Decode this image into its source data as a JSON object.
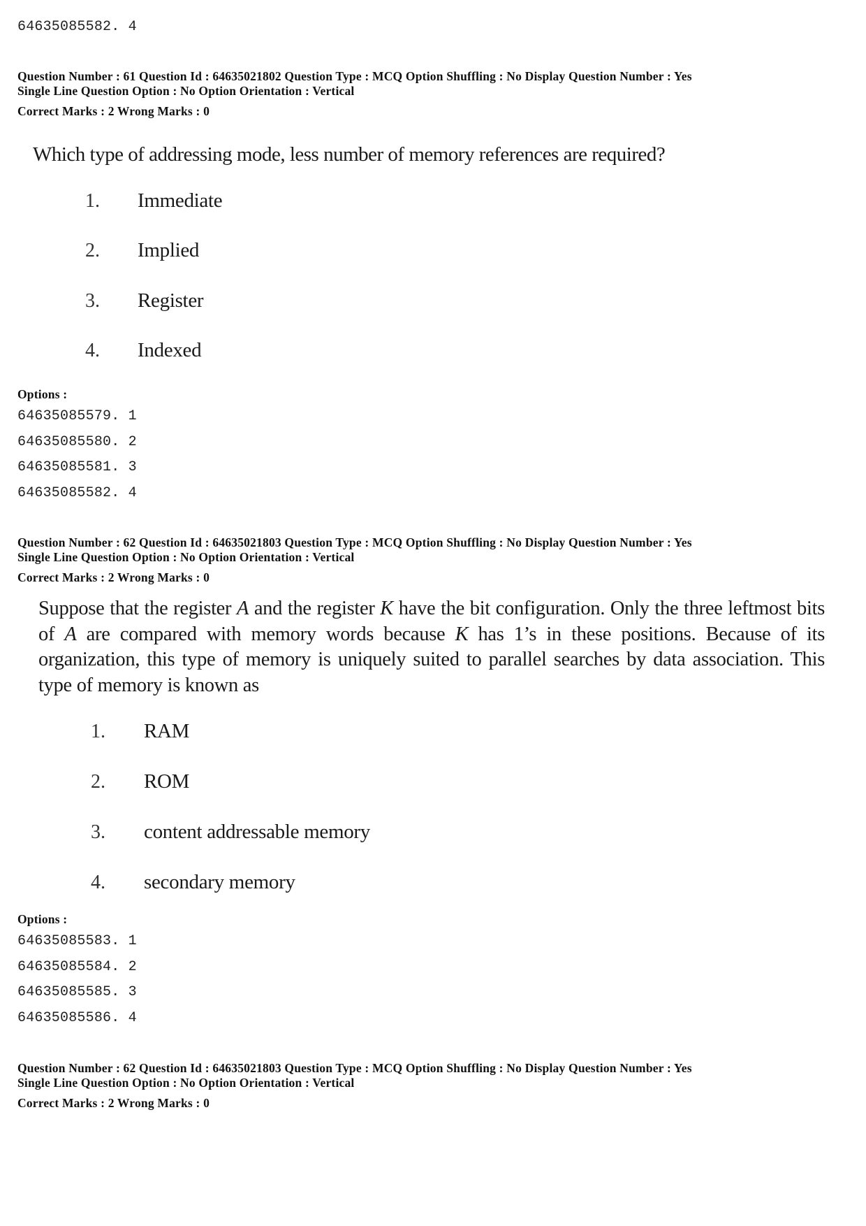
{
  "prev_option_tail": "64635085582. 4",
  "questions": [
    {
      "meta_line1": "Question Number : 61  Question Id : 64635021802  Question Type : MCQ  Option Shuffling : No  Display Question Number : Yes",
      "meta_line2": "Single Line Question Option : No  Option Orientation : Vertical",
      "marks": "Correct Marks : 2  Wrong Marks : 0",
      "text": "Which type of addressing mode, less number of memory references are required?",
      "choices": [
        {
          "num": "1.",
          "label": "Immediate"
        },
        {
          "num": "2.",
          "label": "Implied"
        },
        {
          "num": "3.",
          "label": "Register"
        },
        {
          "num": "4.",
          "label": "Indexed"
        }
      ],
      "options_label": "Options :",
      "option_ids": [
        "64635085579. 1",
        "64635085580. 2",
        "64635085581. 3",
        "64635085582. 4"
      ]
    },
    {
      "meta_line1": "Question Number : 62  Question Id : 64635021803  Question Type : MCQ  Option Shuffling : No  Display Question Number : Yes",
      "meta_line2": "Single Line Question Option : No  Option Orientation : Vertical",
      "marks": "Correct Marks : 2  Wrong Marks : 0",
      "text_parts": {
        "p1": "Suppose that the register ",
        "var_a": "A",
        "p2": " and the register ",
        "var_k": "K",
        "p3": " have the bit configuration. Only the three leftmost bits of ",
        "var_a2": "A",
        "p4": " are compared with memory words because ",
        "var_k2": "K",
        "p5": " has 1’s in these positions. Because of its organization, this type of memory is uniquely suited to parallel searches by data association. This type of memory is known as"
      },
      "choices": [
        {
          "num": "1.",
          "label": "RAM"
        },
        {
          "num": "2.",
          "label": "ROM"
        },
        {
          "num": "3.",
          "label": "content addressable memory"
        },
        {
          "num": "4.",
          "label": "secondary memory"
        }
      ],
      "options_label": "Options :",
      "option_ids": [
        "64635085583. 1",
        "64635085584. 2",
        "64635085585. 3",
        "64635085586. 4"
      ]
    },
    {
      "meta_line1": "Question Number : 62  Question Id : 64635021803  Question Type : MCQ  Option Shuffling : No  Display Question Number : Yes",
      "meta_line2": "Single Line Question Option : No  Option Orientation : Vertical",
      "marks": "Correct Marks : 2  Wrong Marks : 0"
    }
  ]
}
